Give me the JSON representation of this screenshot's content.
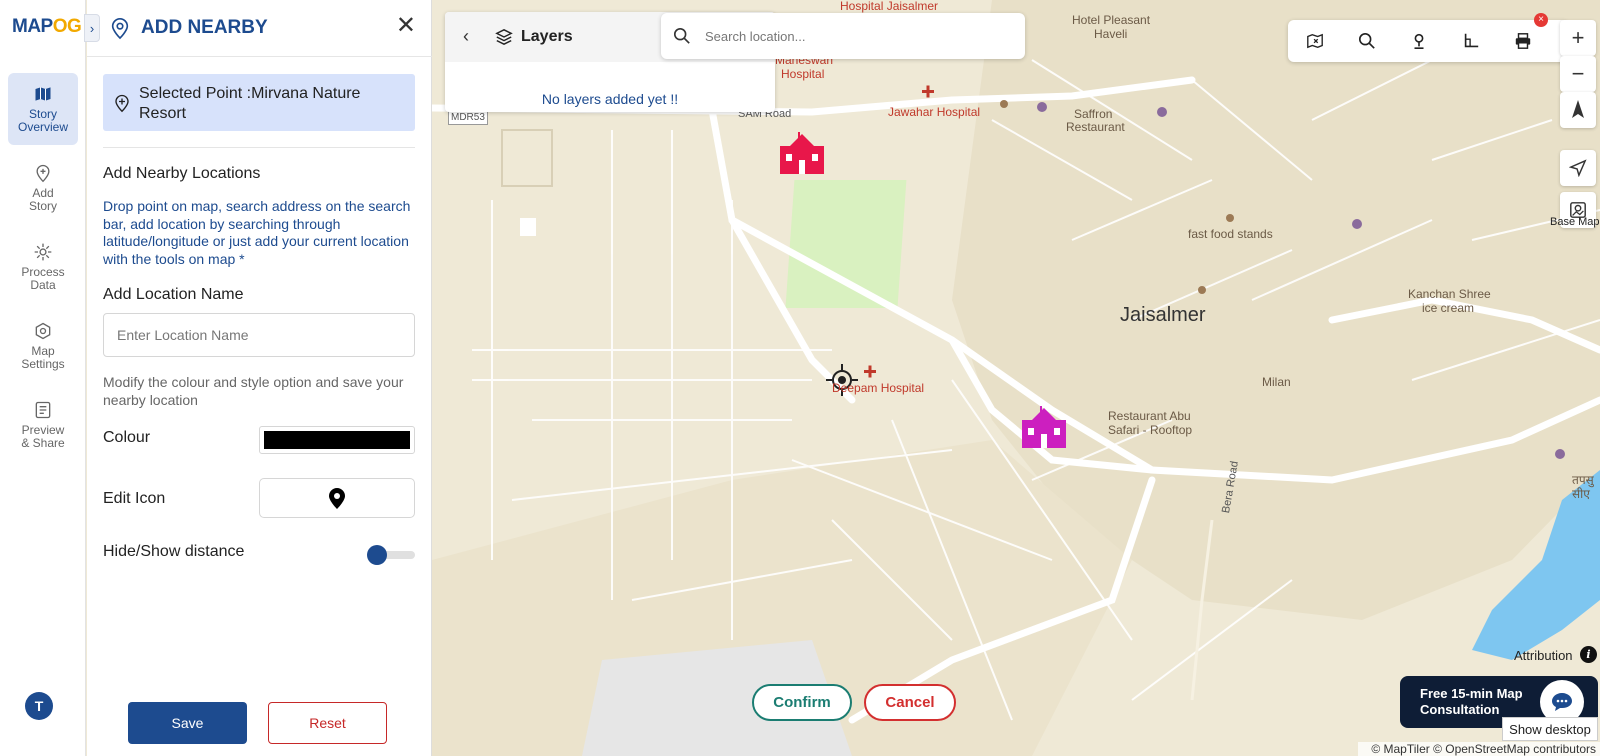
{
  "app": {
    "logo_main": "MAP",
    "logo_accent": "OG",
    "toggle_glyph": "›"
  },
  "rail": {
    "items": [
      {
        "line1": "Story",
        "line2": "Overview",
        "icon": "map-icon"
      },
      {
        "line1": "Add",
        "line2": "Story",
        "icon": "map-pin-plus-icon"
      },
      {
        "line1": "Process",
        "line2": "Data",
        "icon": "gear-icon"
      },
      {
        "line1": "Map",
        "line2": "Settings",
        "icon": "settings-icon"
      },
      {
        "line1": "Preview",
        "line2": "& Share",
        "icon": "preview-icon"
      }
    ],
    "avatar_initial": "T"
  },
  "panel": {
    "title": "ADD NEARBY",
    "close_glyph": "✕",
    "selected_point": "Selected Point :Mirvana Nature Resort",
    "section_title": "Add Nearby Locations",
    "help_text": "Drop point on map, search address on the search bar, add location by searching through latitude/longitude or just add your current location with the tools on map *",
    "location_name_label": "Add Location Name",
    "location_name_placeholder": "Enter Location Name",
    "modify_text": "Modify the colour and style option and save your nearby location",
    "colour_label": "Colour",
    "colour_value": "#000000",
    "edit_icon_label": "Edit Icon",
    "hide_show_label": "Hide/Show distance",
    "save_label": "Save",
    "reset_label": "Reset"
  },
  "map": {
    "layers_title": "Layers",
    "layers_back_glyph": "‹",
    "layers_empty": "No layers added yet !!",
    "search_placeholder": "Search location...",
    "zoom_in": "+",
    "zoom_out": "−",
    "basemap_label": "Base Map",
    "tb_close_glyph": "×",
    "labels": {
      "hospital_jaisalmer": "Hospital Jaisalmer",
      "maneswari": "Maneswari",
      "hospital": "Hospital",
      "sam_road": "SAM Road",
      "mdr53": "MDR53",
      "jawahar": "Jawahar Hospital",
      "hotel_pleasant": "Hotel Pleasant",
      "haveli": "Haveli",
      "saffron": "Saffron",
      "restaurant": "Restaurant",
      "fast_food": "fast food stands",
      "jaisalmer": "Jaisalmer",
      "kanchan": "Kanchan Shree",
      "ice_cream": "ice cream",
      "milan": "Milan",
      "deepam": "Deepam Hospital",
      "abu_safari_1": "Restaurant Abu",
      "abu_safari_2": "Safari - Rooftop",
      "bera_road": "Bera Road",
      "hindi_1": "तपसु",
      "hindi_2": "सीए"
    },
    "confirm_label": "Confirm",
    "cancel_label": "Cancel",
    "attribution_label": "Attribution",
    "attribution_glyph": "i",
    "consult_line1": "Free 15-min Map",
    "consult_line2": "Consultation",
    "show_desktop": "Show desktop",
    "copyright": "© MapTiler © OpenStreetMap contributors"
  }
}
